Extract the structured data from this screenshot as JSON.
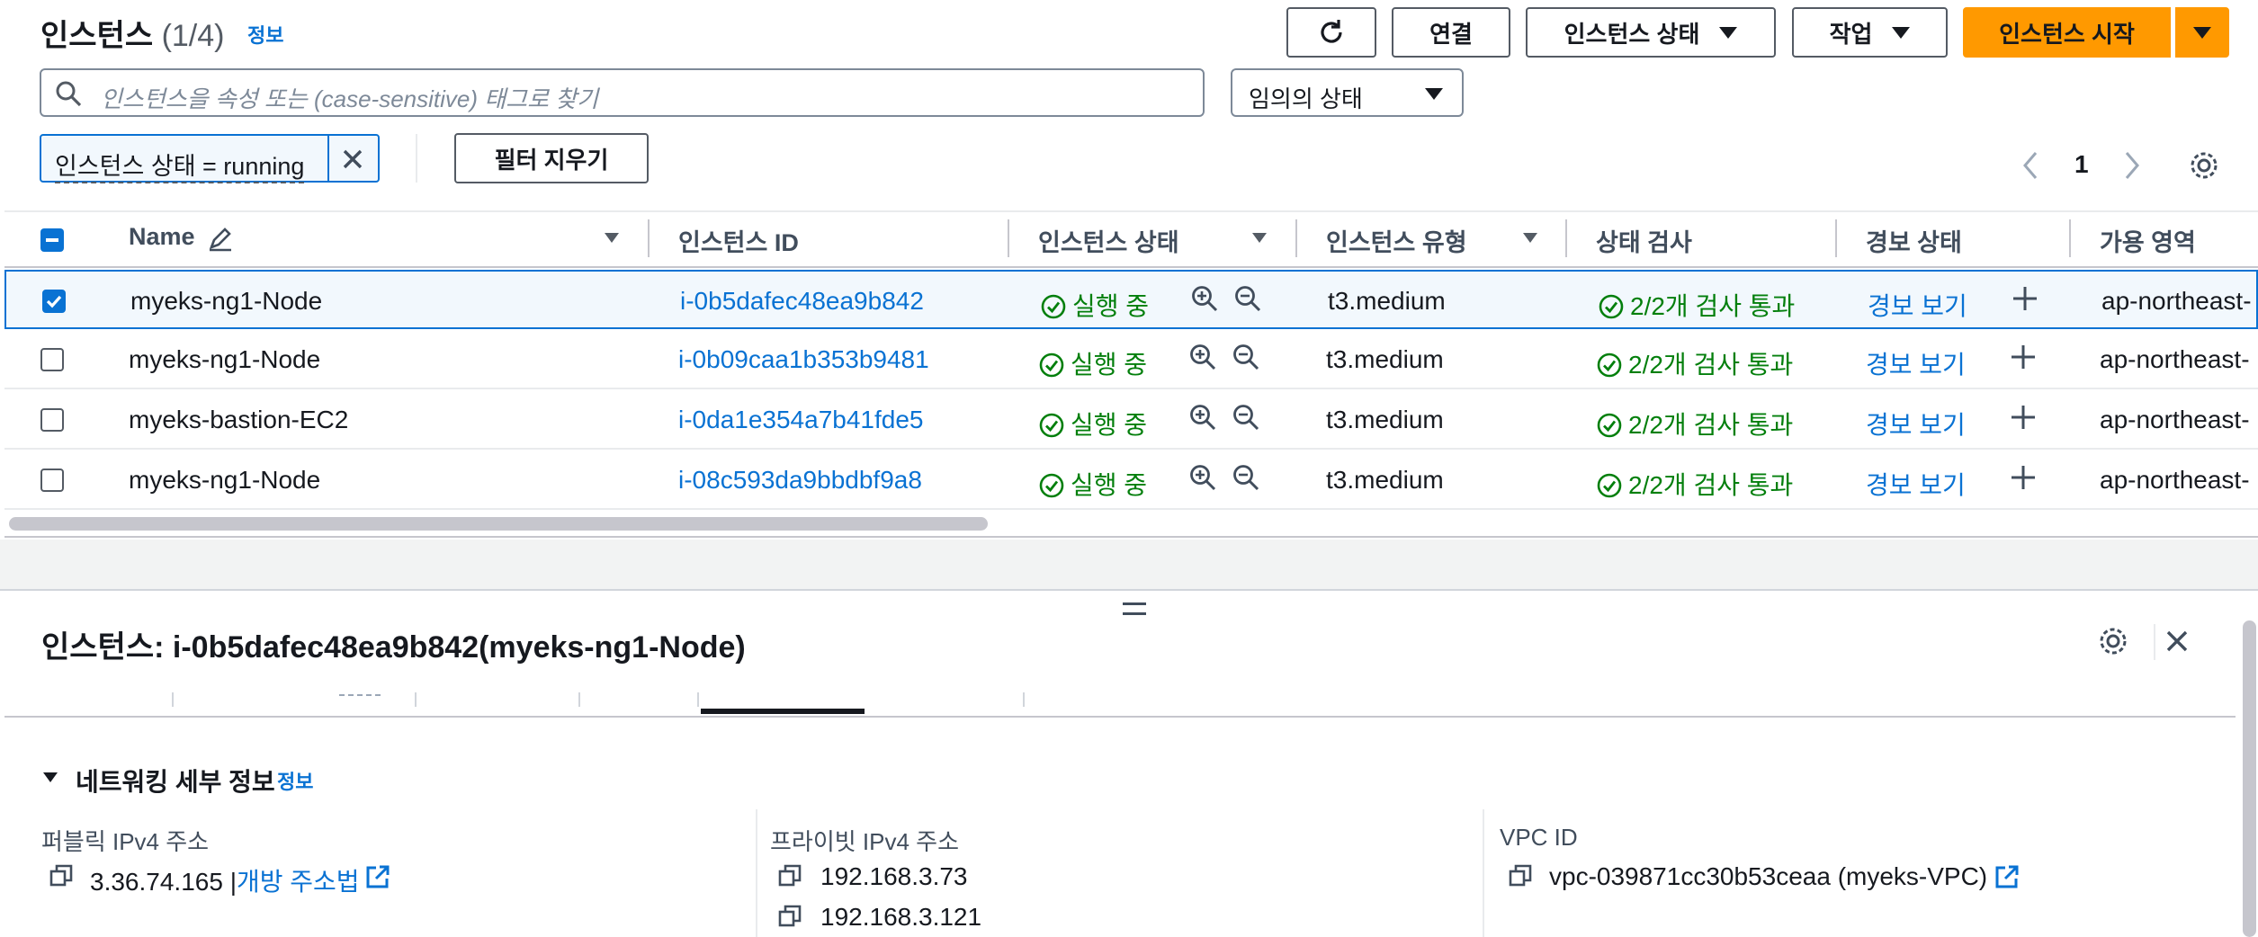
{
  "header": {
    "title": "인스턴스",
    "count": "(1/4)",
    "info": "정보"
  },
  "toolbar": {
    "connect": "연결",
    "instance_state": "인스턴스 상태",
    "actions": "작업",
    "launch": "인스턴스 시작"
  },
  "search": {
    "placeholder": "인스턴스을 속성 또는 (case-sensitive) 태그로 찾기"
  },
  "state_filter": {
    "value": "임의의 상태"
  },
  "active_filter": {
    "label": "인스턴스 상태 = running"
  },
  "clear_filters": "필터 지우기",
  "pagination": {
    "page": "1"
  },
  "columns": [
    "Name",
    "인스턴스 ID",
    "인스턴스 상태",
    "인스턴스 유형",
    "상태 검사",
    "경보 상태",
    "가용 영역"
  ],
  "rows": [
    {
      "name": "myeks-ng1-Node",
      "id": "i-0b5dafec48ea9b842",
      "state": "실행 중",
      "type": "t3.medium",
      "check": "2/2개 검사 통과",
      "alarm": "경보 보기",
      "az": "ap-northeast-",
      "selected": true
    },
    {
      "name": "myeks-ng1-Node",
      "id": "i-0b09caa1b353b9481",
      "state": "실행 중",
      "type": "t3.medium",
      "check": "2/2개 검사 통과",
      "alarm": "경보 보기",
      "az": "ap-northeast-",
      "selected": false
    },
    {
      "name": "myeks-bastion-EC2",
      "id": "i-0da1e354a7b41fde5",
      "state": "실행 중",
      "type": "t3.medium",
      "check": "2/2개 검사 통과",
      "alarm": "경보 보기",
      "az": "ap-northeast-",
      "selected": false
    },
    {
      "name": "myeks-ng1-Node",
      "id": "i-08c593da9bbdbf9a8",
      "state": "실행 중",
      "type": "t3.medium",
      "check": "2/2개 검사 통과",
      "alarm": "경보 보기",
      "az": "ap-northeast-",
      "selected": false
    }
  ],
  "detail": {
    "title": "인스턴스: i-0b5dafec48ea9b842(myeks-ng1-Node)",
    "section": "네트워킹 세부 정보",
    "section_info": "정보",
    "public_label": "퍼블릭 IPv4 주소",
    "public_ip": "3.36.74.165",
    "public_link": "개방 주소법",
    "private_label": "프라이빗 IPv4 주소",
    "private_ips": [
      "192.168.3.73",
      "192.168.3.121"
    ],
    "vpc_label": "VPC ID",
    "vpc_value": "vpc-039871cc30b53ceaa (myeks-VPC)"
  },
  "colors": {
    "primary": "#ff9900",
    "link": "#0972d3",
    "success": "#037f0c",
    "selected_bg": "#f2f8fd"
  }
}
